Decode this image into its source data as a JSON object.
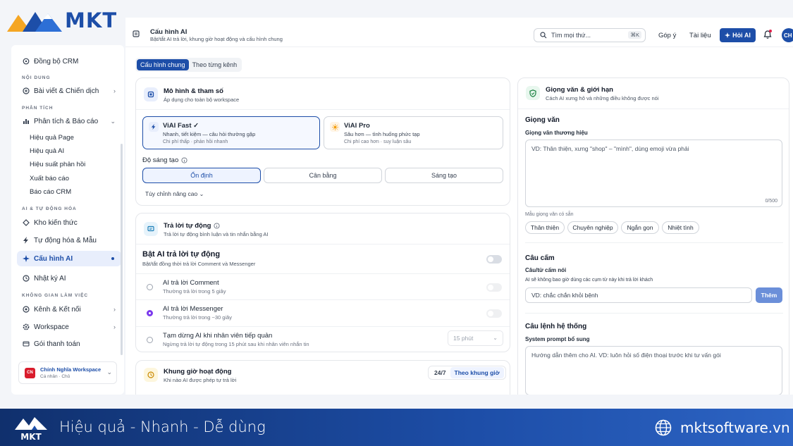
{
  "brand": {
    "logo_text": "MKT"
  },
  "sidebar": {
    "top_item": "Đồng bộ CRM",
    "sections": {
      "noi_dung": "NỘI DUNG",
      "phan_tich": "PHÂN TÍCH",
      "ai": "AI & TỰ ĐỘNG HÓA",
      "workspace": "KHÔNG GIAN LÀM VIỆC"
    },
    "items": {
      "bai_viet": "Bài viết & Chiến dịch",
      "phan_tich": "Phân tích & Báo cáo",
      "kho": "Kho kiến thức",
      "tu_dong": "Tự động hóa & Mẫu",
      "cau_hinh": "Cấu hình AI",
      "nhat_ky": "Nhật ký AI",
      "kenh": "Kênh & Kết nối",
      "workspace": "Workspace",
      "goi": "Gói thanh toán"
    },
    "subitems": [
      "Hiệu quả Page",
      "Hiệu quả AI",
      "Hiệu suất phản hồi",
      "Xuất báo cáo",
      "Báo cáo CRM"
    ],
    "workspace_card": {
      "initials": "CN",
      "name": "Chính Nghĩa Workspace",
      "role": "Cá nhân · Chủ"
    }
  },
  "topbar": {
    "title": "Cấu hình AI",
    "subtitle": "Bật/tắt AI trả lời, khung giờ hoạt động và cấu hình chung",
    "search_placeholder": "Tìm mọi thứ...",
    "shortcut": "⌘K",
    "feedback": "Góp ý",
    "docs": "Tài liệu",
    "ask_ai": "Hỏi AI",
    "avatar": "CH"
  },
  "tabs": [
    "Cấu hình chung",
    "Theo từng kênh"
  ],
  "model_card": {
    "title": "Mô hình & tham số",
    "subtitle": "Áp dụng cho toàn bộ workspace",
    "options": [
      {
        "name": "ViAI Fast ✓",
        "desc": "Nhanh, tiết kiệm — câu hỏi thường gặp",
        "cost": "Chi phí thấp · phản hồi nhanh"
      },
      {
        "name": "ViAI Pro",
        "desc": "Sâu hơn — tình huống phức tạp",
        "cost": "Chi phí cao hơn · suy luận sâu"
      }
    ],
    "creativity_label": "Độ sáng tạo",
    "creativity_levels": [
      "Ổn định",
      "Cân bằng",
      "Sáng tạo"
    ],
    "advanced": "Tùy chỉnh nâng cao"
  },
  "auto_reply": {
    "title": "Trả lời tự động",
    "subtitle": "Trả lời tự động bình luận và tin nhắn bằng AI",
    "master_title": "Bật AI trả lời tự động",
    "master_sub": "Bật/tắt đồng thời trả lời Comment và Messenger",
    "rows": [
      {
        "title": "AI trả lời Comment",
        "sub": "Thường trả lời trong 5 giây"
      },
      {
        "title": "AI trả lời Messenger",
        "sub": "Thường trả lời trong ~30 giây"
      },
      {
        "title": "Tạm dừng AI khi nhân viên tiếp quản",
        "sub": "Ngừng trả lời tự động trong 15 phút sau khi nhân viên nhắn tin"
      }
    ],
    "pause_select": "15 phút"
  },
  "hours": {
    "title": "Khung giờ hoạt động",
    "subtitle": "Khi nào AI được phép tự trả lời",
    "mode_247": "24/7",
    "mode_schedule": "Theo khung giờ"
  },
  "tone_card": {
    "title": "Giọng văn & giới hạn",
    "subtitle": "Cách AI xưng hô và những điều không được nói",
    "tone_section": "Giọng văn",
    "brand_tone_label": "Giọng văn thương hiệu",
    "brand_tone_placeholder": "VD: Thân thiện, xưng \"shop\" – \"mình\", dùng emoji vừa phải",
    "counter": "0/500",
    "presets_label": "Mẫu giọng văn có sẵn",
    "presets": [
      "Thân thiện",
      "Chuyên nghiệp",
      "Ngắn gọn",
      "Nhiệt tình"
    ],
    "banned_section": "Câu cấm",
    "banned_label": "Câu/từ cấm nói",
    "banned_hint": "AI sẽ không bao giờ dùng các cụm từ này khi trả lời khách",
    "banned_placeholder": "VD: chắc chắn khỏi bệnh",
    "add_button": "Thêm",
    "system_section": "Câu lệnh hệ thống",
    "system_label": "System prompt bổ sung",
    "system_placeholder": "Hướng dẫn thêm cho AI. VD: luôn hỏi số điện thoại trước khi tư vấn gói"
  },
  "footer": {
    "logo_text": "MKT",
    "tagline": "Hiệu quả - Nhanh - Dễ dùng",
    "website": "mktsoftware.vn"
  },
  "colors": {
    "primary": "#1d4ea8",
    "footer_start": "#10306d",
    "accent_purple": "#7c3aed"
  }
}
